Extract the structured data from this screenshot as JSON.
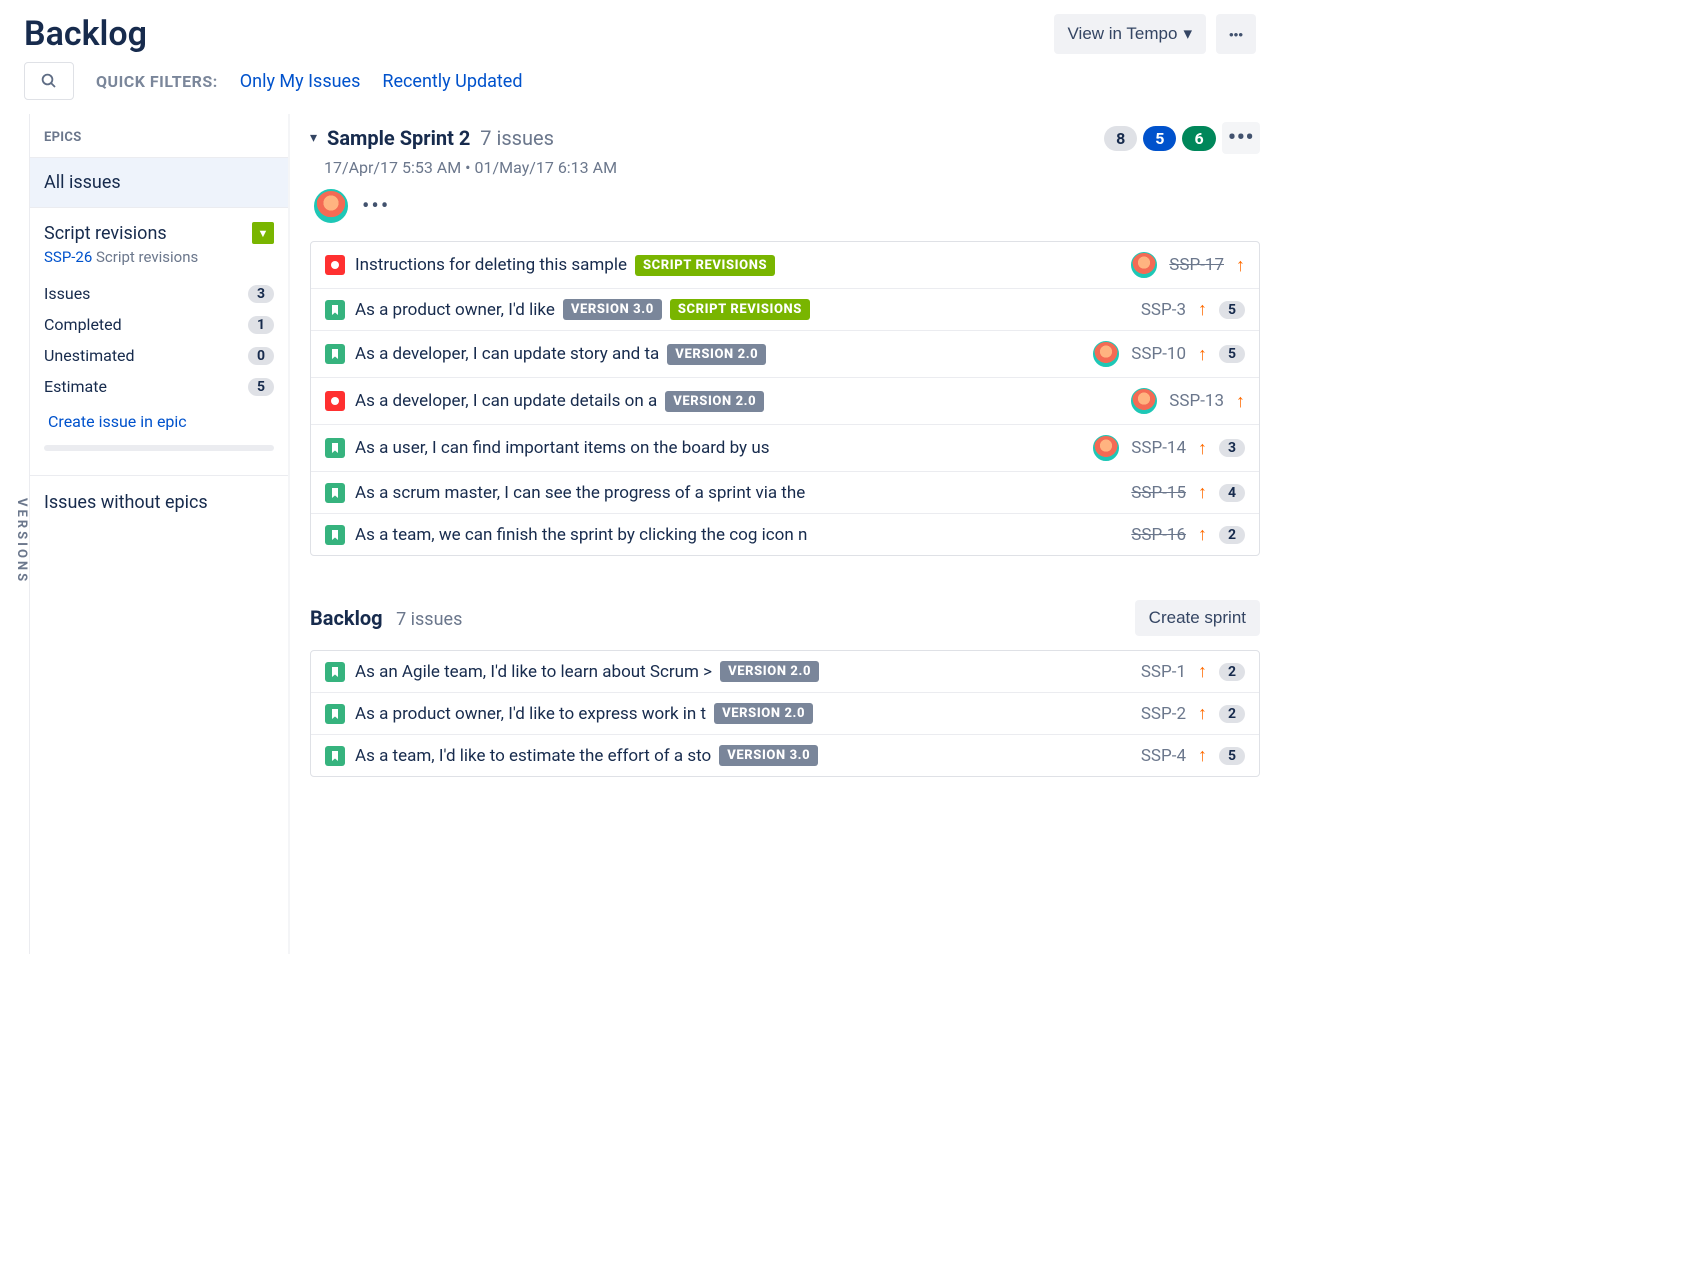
{
  "header": {
    "title": "Backlog",
    "view_in_tempo": "View in Tempo"
  },
  "filters": {
    "label": "QUICK FILTERS:",
    "only_my": "Only My Issues",
    "recent": "Recently Updated"
  },
  "versions_label": "VERSIONS",
  "epics": {
    "header": "EPICS",
    "all": "All issues",
    "selected": {
      "name": "Script revisions",
      "key": "SSP-26",
      "key_text": "Script revisions",
      "stats": [
        {
          "label": "Issues",
          "value": "3"
        },
        {
          "label": "Completed",
          "value": "1"
        },
        {
          "label": "Unestimated",
          "value": "0"
        },
        {
          "label": "Estimate",
          "value": "5"
        }
      ],
      "create": "Create issue in epic"
    },
    "without": "Issues without epics"
  },
  "sprint": {
    "name": "Sample Sprint 2",
    "count": "7 issues",
    "dates": "17/Apr/17 5:53 AM • 01/May/17 6:13 AM",
    "pills": {
      "gray": "8",
      "blue": "5",
      "green": "6"
    },
    "issues": [
      {
        "type": "bug",
        "summary": "Instructions for deleting this sample",
        "tags": [
          {
            "text": "SCRIPT REVISIONS",
            "cls": "lz-green"
          }
        ],
        "avatar": true,
        "key": "SSP-17",
        "struck": true,
        "points": ""
      },
      {
        "type": "story",
        "summary": "As a product owner, I'd like",
        "tags": [
          {
            "text": "VERSION 3.0",
            "cls": "lz-purple"
          },
          {
            "text": "SCRIPT REVISIONS",
            "cls": "lz-green"
          }
        ],
        "avatar": false,
        "key": "SSP-3",
        "struck": false,
        "points": "5"
      },
      {
        "type": "story",
        "summary": "As a developer, I can update story and ta",
        "tags": [
          {
            "text": "VERSION 2.0",
            "cls": "lz-purple"
          }
        ],
        "avatar": true,
        "key": "SSP-10",
        "struck": false,
        "points": "5"
      },
      {
        "type": "bug",
        "summary": "As a developer, I can update details on a",
        "tags": [
          {
            "text": "VERSION 2.0",
            "cls": "lz-purple"
          }
        ],
        "avatar": true,
        "key": "SSP-13",
        "struck": false,
        "points": ""
      },
      {
        "type": "story",
        "summary": "As a user, I can find important items on the board by us",
        "tags": [],
        "avatar": true,
        "key": "SSP-14",
        "struck": false,
        "points": "3"
      },
      {
        "type": "story",
        "summary": "As a scrum master, I can see the progress of a sprint via the",
        "tags": [],
        "avatar": false,
        "key": "SSP-15",
        "struck": true,
        "points": "4"
      },
      {
        "type": "story",
        "summary": "As a team, we can finish the sprint by clicking the cog icon n",
        "tags": [],
        "avatar": false,
        "key": "SSP-16",
        "struck": true,
        "points": "2"
      }
    ]
  },
  "backlog": {
    "title": "Backlog",
    "count": "7 issues",
    "create_sprint": "Create sprint",
    "issues": [
      {
        "type": "story",
        "summary": "As an Agile team, I'd like to learn about Scrum >",
        "tags": [
          {
            "text": "VERSION 2.0",
            "cls": "lz-purple"
          }
        ],
        "avatar": false,
        "key": "SSP-1",
        "struck": false,
        "points": "2"
      },
      {
        "type": "story",
        "summary": "As a product owner, I'd like to express work in t",
        "tags": [
          {
            "text": "VERSION 2.0",
            "cls": "lz-purple"
          }
        ],
        "avatar": false,
        "key": "SSP-2",
        "struck": false,
        "points": "2"
      },
      {
        "type": "story",
        "summary": "As a team, I'd like to estimate the effort of a sto",
        "tags": [
          {
            "text": "VERSION 3.0",
            "cls": "lz-purple"
          }
        ],
        "avatar": false,
        "key": "SSP-4",
        "struck": false,
        "points": "5"
      }
    ]
  }
}
